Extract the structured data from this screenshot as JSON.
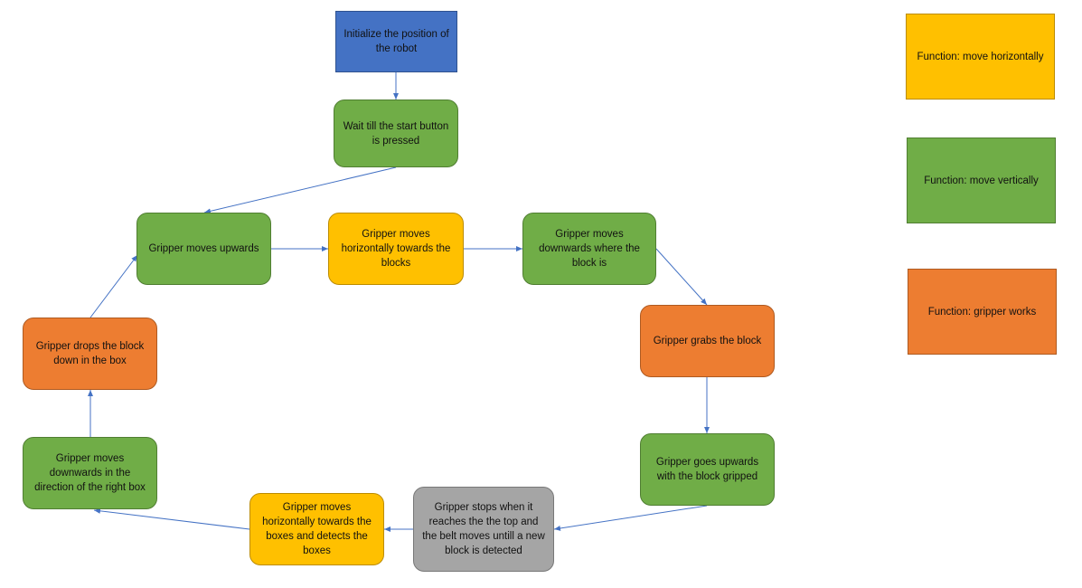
{
  "colors": {
    "start": "#4472c4",
    "vertical": "#70ad47",
    "horizontal": "#ffc000",
    "gripper": "#ed7d31",
    "wait": "#a5a5a5",
    "arrow": "#4472c4"
  },
  "nodes": {
    "init": "Initialize the position of the robot",
    "wait_start": "Wait till the start button is pressed",
    "moves_up": "Gripper moves upwards",
    "horiz_blocks": "Gripper moves horizontally  towards the blocks",
    "down_block": "Gripper moves downwards where the block is",
    "grabs": "Gripper grabs the block",
    "goes_up": "Gripper goes upwards with the  block gripped",
    "stops": "Gripper stops when it reaches the the top and the belt moves untill a new block is detected",
    "horiz_boxes": "Gripper moves horizontally towards the boxes and detects the boxes",
    "down_box": "Gripper moves downwards in the direction of the right box",
    "drops": "Gripper drops the block down in the box"
  },
  "legend": [
    {
      "label": "Function: move horizontally",
      "color": "#ffc000"
    },
    {
      "label": "Function: move vertically",
      "color": "#70ad47"
    },
    {
      "label": "Function: gripper works",
      "color": "#ed7d31"
    }
  ],
  "edges": [
    [
      "init",
      "wait_start"
    ],
    [
      "wait_start",
      "moves_up"
    ],
    [
      "moves_up",
      "horiz_blocks"
    ],
    [
      "horiz_blocks",
      "down_block"
    ],
    [
      "down_block",
      "grabs"
    ],
    [
      "grabs",
      "goes_up"
    ],
    [
      "goes_up",
      "stops"
    ],
    [
      "stops",
      "horiz_boxes"
    ],
    [
      "horiz_boxes",
      "down_box"
    ],
    [
      "down_box",
      "drops"
    ],
    [
      "drops",
      "moves_up"
    ]
  ]
}
